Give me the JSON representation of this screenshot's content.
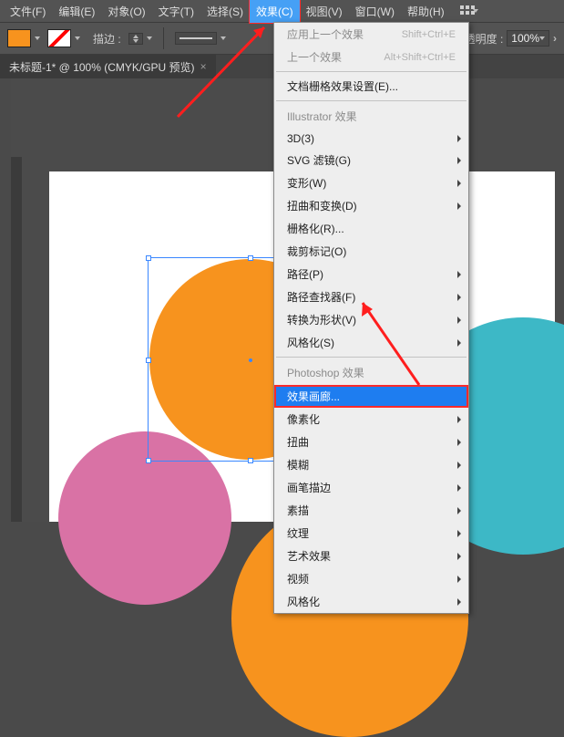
{
  "menubar": {
    "items": [
      "文件(F)",
      "编辑(E)",
      "对象(O)",
      "文字(T)",
      "选择(S)",
      "效果(C)",
      "视图(V)",
      "窗口(W)",
      "帮助(H)"
    ],
    "active_index": 5
  },
  "toolbar": {
    "stroke_label": "描边 :",
    "opacity_label": "透明度 :",
    "opacity_value": "100%"
  },
  "tab": {
    "title": "未标题-1* @ 100% (CMYK/GPU 预览)"
  },
  "dropdown": {
    "top": [
      {
        "label": "应用上一个效果",
        "shortcut": "Shift+Ctrl+E",
        "disabled": true
      },
      {
        "label": "上一个效果",
        "shortcut": "Alt+Shift+Ctrl+E",
        "disabled": true
      }
    ],
    "docgrid": "文档栅格效果设置(E)...",
    "header1": "Illustrator 效果",
    "group1": [
      {
        "label": "3D(3)",
        "sub": true
      },
      {
        "label": "SVG 滤镜(G)",
        "sub": true
      },
      {
        "label": "变形(W)",
        "sub": true
      },
      {
        "label": "扭曲和变换(D)",
        "sub": true
      },
      {
        "label": "栅格化(R)...",
        "sub": false
      },
      {
        "label": "裁剪标记(O)",
        "sub": false
      },
      {
        "label": "路径(P)",
        "sub": true
      },
      {
        "label": "路径查找器(F)",
        "sub": true
      },
      {
        "label": "转换为形状(V)",
        "sub": true
      },
      {
        "label": "风格化(S)",
        "sub": true
      }
    ],
    "header2": "Photoshop 效果",
    "highlight": "效果画廊...",
    "group2": [
      {
        "label": "像素化",
        "sub": true
      },
      {
        "label": "扭曲",
        "sub": true
      },
      {
        "label": "模糊",
        "sub": true
      },
      {
        "label": "画笔描边",
        "sub": true
      },
      {
        "label": "素描",
        "sub": true
      },
      {
        "label": "纹理",
        "sub": true
      },
      {
        "label": "艺术效果",
        "sub": true
      },
      {
        "label": "视频",
        "sub": true
      },
      {
        "label": "风格化",
        "sub": true
      }
    ]
  }
}
